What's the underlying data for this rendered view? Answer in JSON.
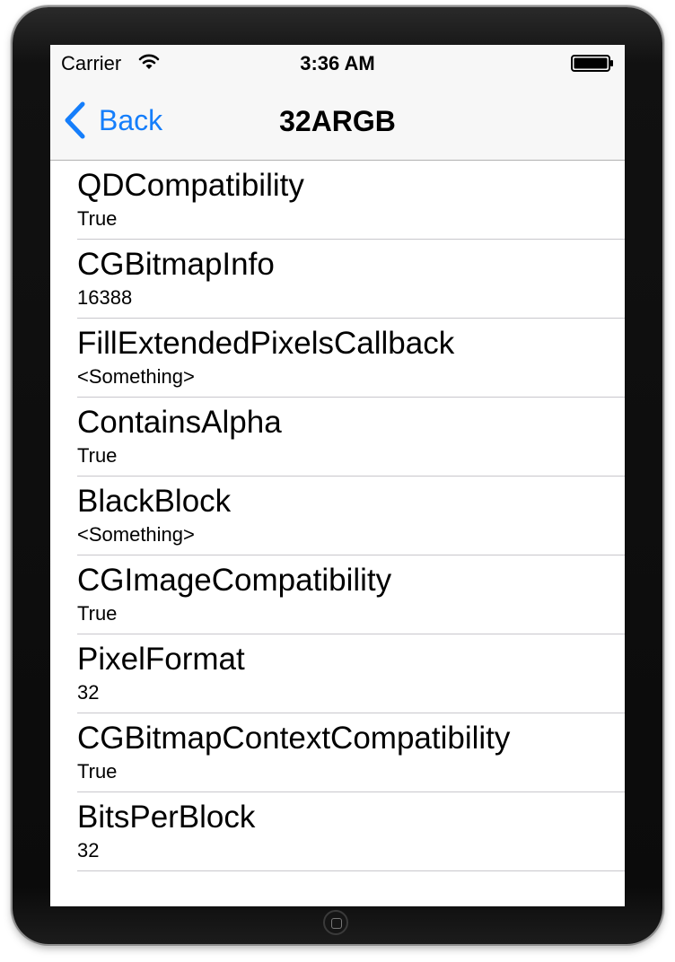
{
  "status_bar": {
    "carrier": "Carrier",
    "time": "3:36 AM",
    "wifi_icon": "wifi-icon",
    "battery_icon": "battery-icon"
  },
  "nav": {
    "back_label": "Back",
    "back_icon": "chevron-left-icon",
    "title": "32ARGB",
    "accent_color": "#157efb"
  },
  "rows": [
    {
      "title": "QDCompatibility",
      "subtitle": "True"
    },
    {
      "title": "CGBitmapInfo",
      "subtitle": "16388"
    },
    {
      "title": "FillExtendedPixelsCallback",
      "subtitle": "<Something>"
    },
    {
      "title": "ContainsAlpha",
      "subtitle": "True"
    },
    {
      "title": "BlackBlock",
      "subtitle": "<Something>"
    },
    {
      "title": "CGImageCompatibility",
      "subtitle": "True"
    },
    {
      "title": "PixelFormat",
      "subtitle": "32"
    },
    {
      "title": "CGBitmapContextCompatibility",
      "subtitle": "True"
    },
    {
      "title": "BitsPerBlock",
      "subtitle": "32"
    }
  ]
}
